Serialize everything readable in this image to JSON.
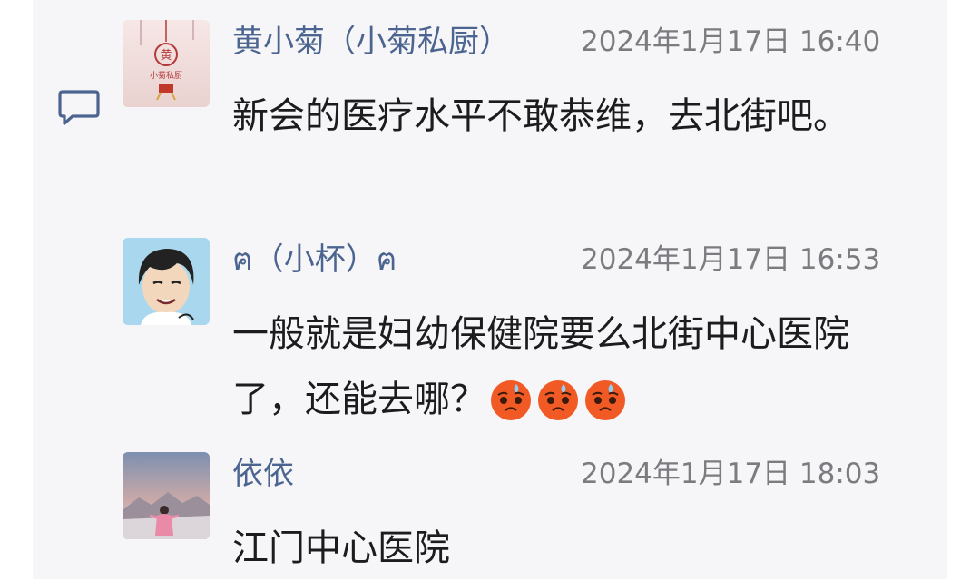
{
  "icons": {
    "comment": "comment-icon",
    "emoji": "anxious-face-with-sweat-emoji"
  },
  "colors": {
    "background": "#ffffff",
    "panel": "#f6f6f8",
    "name": "#4c6590",
    "time": "#7b7b80",
    "text": "#1c1c1e",
    "icon": "#4c6590"
  },
  "comments": [
    {
      "name": "黄小菊（小菊私厨）",
      "time": "2024年1月17日 16:40",
      "text": "新会的医疗水平不敢恭维，去北街吧。",
      "avatar": {
        "logo_char": "黄",
        "logo_text": "小菊私厨"
      }
    },
    {
      "name": "ฅ（小杯）ฅ",
      "time": "2024年1月17日 16:53",
      "text": "一般就是妇幼保健院要么北街中心医院了，还能去哪？",
      "emoji_count": 3
    },
    {
      "name": "依依",
      "time": "2024年1月17日 18:03",
      "text": "江门中心医院"
    }
  ]
}
